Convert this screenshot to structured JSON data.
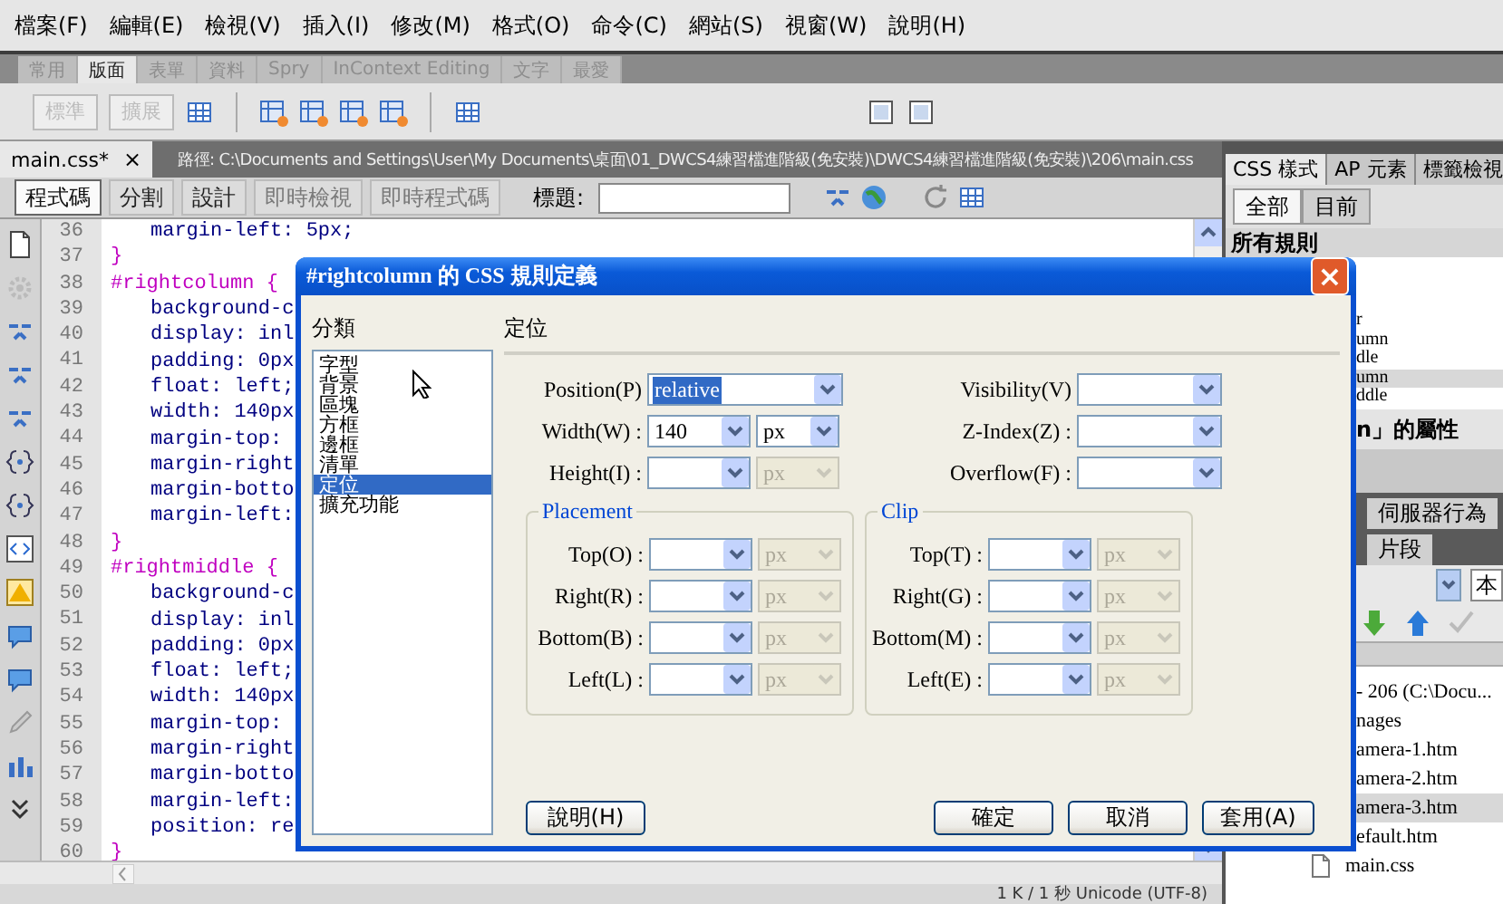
{
  "menu": [
    "檔案(F)",
    "編輯(E)",
    "檢視(V)",
    "插入(I)",
    "修改(M)",
    "格式(O)",
    "命令(C)",
    "網站(S)",
    "視窗(W)",
    "說明(H)"
  ],
  "insert_tabs": [
    {
      "label": "常用",
      "selected": false
    },
    {
      "label": "版面",
      "selected": true
    },
    {
      "label": "表單",
      "selected": false
    },
    {
      "label": "資料",
      "selected": false
    },
    {
      "label": "Spry",
      "selected": false
    },
    {
      "label": "InContext Editing",
      "selected": false
    },
    {
      "label": "文字",
      "selected": false
    },
    {
      "label": "最愛",
      "selected": false
    }
  ],
  "layout_modes": [
    {
      "label": "標準",
      "disabled": true
    },
    {
      "label": "擴展",
      "disabled": true
    }
  ],
  "document": {
    "tab": "main.css*",
    "close": "×",
    "path": "路徑:  C:\\Documents and Settings\\User\\My Documents\\桌面\\01_DWCS4練習檔進階級(免安裝)\\DWCS4練習檔進階級(免安裝)\\206\\main.css"
  },
  "views": [
    {
      "label": "程式碼",
      "selected": true
    },
    {
      "label": "分割",
      "selected": false
    },
    {
      "label": "設計",
      "selected": false
    }
  ],
  "live_buttons": [
    {
      "label": "即時檢視",
      "disabled": true
    },
    {
      "label": "即時程式碼",
      "disabled": true
    }
  ],
  "title_label": "標題:",
  "code_lines": [
    {
      "number": "36",
      "text": "margin-left: 5px;",
      "kind": "property"
    },
    {
      "number": "37",
      "text": "}",
      "kind": "brace"
    },
    {
      "number": "38",
      "text": "#rightcolumn {",
      "kind": "selector"
    },
    {
      "number": "39",
      "text": "background-c",
      "kind": "property"
    },
    {
      "number": "40",
      "text": "display: inl",
      "kind": "property"
    },
    {
      "number": "41",
      "text": "padding: 0px",
      "kind": "property"
    },
    {
      "number": "42",
      "text": "float: left;",
      "kind": "property"
    },
    {
      "number": "43",
      "text": "width: 140px",
      "kind": "property"
    },
    {
      "number": "44",
      "text": "margin-top:",
      "kind": "property"
    },
    {
      "number": "45",
      "text": "margin-right",
      "kind": "property"
    },
    {
      "number": "46",
      "text": "margin-botto",
      "kind": "property"
    },
    {
      "number": "47",
      "text": "margin-left:",
      "kind": "property"
    },
    {
      "number": "48",
      "text": "}",
      "kind": "brace"
    },
    {
      "number": "49",
      "text": "#rightmiddle {",
      "kind": "selector"
    },
    {
      "number": "50",
      "text": "background-c",
      "kind": "property"
    },
    {
      "number": "51",
      "text": "display: inl",
      "kind": "property"
    },
    {
      "number": "52",
      "text": "padding: 0px",
      "kind": "property"
    },
    {
      "number": "53",
      "text": "float: left;",
      "kind": "property"
    },
    {
      "number": "54",
      "text": "width: 140px",
      "kind": "property"
    },
    {
      "number": "55",
      "text": "margin-top:",
      "kind": "property"
    },
    {
      "number": "56",
      "text": "margin-right",
      "kind": "property"
    },
    {
      "number": "57",
      "text": "margin-botto",
      "kind": "property"
    },
    {
      "number": "58",
      "text": "margin-left:",
      "kind": "property"
    },
    {
      "number": "59",
      "text": "position: re",
      "kind": "property"
    },
    {
      "number": "60",
      "text": "}",
      "kind": "brace"
    }
  ],
  "status_bar": "1 K / 1 秒  Unicode (UTF-8)",
  "panel": {
    "tabs": [
      {
        "label": "CSS 樣式",
        "selected": true
      },
      {
        "label": "AP 元素",
        "selected": false
      },
      {
        "label": "標籤檢視",
        "selected": false
      }
    ],
    "modes": [
      {
        "label": "全部",
        "selected": true
      },
      {
        "label": "目前",
        "selected": false
      }
    ],
    "rules_heading": "所有規則",
    "rules": [
      {
        "text": "r",
        "selected": false
      },
      {
        "text": "umn",
        "selected": false
      },
      {
        "text": "dle",
        "selected": false
      },
      {
        "text": "umn",
        "selected": true
      },
      {
        "text": "ddle",
        "selected": false
      }
    ],
    "properties_heading": "n」的屬性",
    "server_tab": "伺服器行為",
    "snippets_tab": "片段",
    "site_button": "本",
    "files": [
      {
        "name": "- 206 (C:\\Docu...",
        "selected": false
      },
      {
        "name": "nages",
        "selected": false
      },
      {
        "name": "amera-1.htm",
        "selected": false
      },
      {
        "name": "amera-2.htm",
        "selected": false
      },
      {
        "name": "amera-3.htm",
        "selected": true
      },
      {
        "name": "efault.htm",
        "selected": false
      },
      {
        "name": "main.css",
        "selected": false
      }
    ]
  },
  "dialog": {
    "title": "#rightcolumn 的 CSS 規則定義",
    "close": "×",
    "category_label": "分類",
    "categories": [
      {
        "label": "字型",
        "selected": false
      },
      {
        "label": "背景",
        "selected": false
      },
      {
        "label": "區塊",
        "selected": false
      },
      {
        "label": "方框",
        "selected": false
      },
      {
        "label": "邊框",
        "selected": false
      },
      {
        "label": "清單",
        "selected": false
      },
      {
        "label": "定位",
        "selected": true
      },
      {
        "label": "擴充功能",
        "selected": false
      }
    ],
    "section": "定位",
    "fields_left": [
      {
        "label": "Position(P)",
        "value": "relative",
        "value_selected": true
      },
      {
        "label": "Width(W) :",
        "value": "140",
        "unit": "px",
        "unit_disabled": false
      },
      {
        "label": "Height(I) :",
        "unit": "px",
        "unit_disabled": true
      }
    ],
    "fields_right": [
      {
        "label": "Visibility(V)"
      },
      {
        "label": "Z-Index(Z) :"
      },
      {
        "label": "Overflow(F) :"
      }
    ],
    "placement": {
      "legend": "Placement",
      "fields": [
        {
          "label": "Top(O) :",
          "unit": "px",
          "unit_disabled": true
        },
        {
          "label": "Right(R) :",
          "unit": "px",
          "unit_disabled": true
        },
        {
          "label": "Bottom(B) :",
          "unit": "px",
          "unit_disabled": true
        },
        {
          "label": "Left(L) :",
          "unit": "px",
          "unit_disabled": true
        }
      ]
    },
    "clip": {
      "legend": "Clip",
      "fields": [
        {
          "label": "Top(T) :",
          "unit": "px",
          "unit_disabled": true
        },
        {
          "label": "Right(G) :",
          "unit": "px",
          "unit_disabled": true
        },
        {
          "label": "Bottom(M) :",
          "unit": "px",
          "unit_disabled": true
        },
        {
          "label": "Left(E) :",
          "unit": "px",
          "unit_disabled": true
        }
      ]
    },
    "help_button": "說明(H)",
    "buttons": [
      "確定",
      "取消",
      "套用(A)"
    ]
  }
}
